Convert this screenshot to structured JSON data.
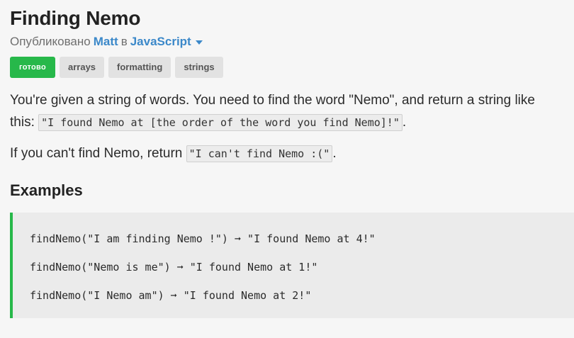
{
  "kata": {
    "title": "Finding Nemo",
    "published_prefix": "Опубликовано",
    "author": "Matt",
    "in_word": "в",
    "language": "JavaScript"
  },
  "tags": [
    {
      "label": "готово"
    },
    {
      "label": "arrays"
    },
    {
      "label": "formatting"
    },
    {
      "label": "strings"
    }
  ],
  "description": {
    "p1_text_a": "You're given a string of words. You need to find the word \"Nemo\", and return a string like this: ",
    "p1_code": "\"I found Nemo at [the order of the word you find Nemo]!\"",
    "p1_text_b": ".",
    "p2_text_a": "If you can't find Nemo, return ",
    "p2_code": "\"I can't find Nemo :(\"",
    "p2_text_b": "."
  },
  "examples": {
    "heading": "Examples",
    "lines": [
      "findNemo(\"I am finding Nemo !\") ➞ \"I found Nemo at 4!\"",
      "findNemo(\"Nemo is me\") ➞ \"I found Nemo at 1!\"",
      "findNemo(\"I Nemo am\") ➞ \"I found Nemo at 2!\""
    ]
  },
  "colors": {
    "accent_blue": "#3b88c9",
    "status_green": "#27b84a",
    "tag_gray": "#e2e2e2"
  }
}
